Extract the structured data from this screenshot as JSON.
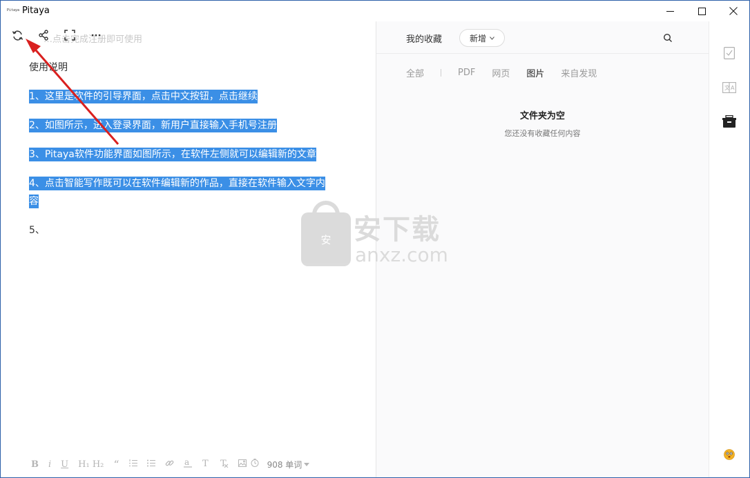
{
  "window": {
    "app_title": "Pitaya",
    "app_logo_text": "Pitaya"
  },
  "editor": {
    "ghost_text": "…点击完成注册即可使用",
    "paragraphs": [
      {
        "text": "使用说明",
        "highlighted": false
      },
      {
        "text": "1、这里是软件的引导界面，点击中文按钮，点击继续",
        "highlighted": true
      },
      {
        "text": "2、如图所示，进入登录界面，新用户直接输入手机号注册",
        "highlighted": true
      },
      {
        "text": "3、Pitaya软件功能界面如图所示，在软件左侧就可以编辑新的文章",
        "highlighted": true
      },
      {
        "text": "4、点击智能写作既可以在软件编辑新的作品，直接在软件输入文字内容",
        "highlighted": true
      },
      {
        "text": "5、",
        "highlighted": false
      }
    ],
    "format_bar": {
      "bold": "B",
      "italic": "i",
      "underline": "U",
      "headings": "H₁ H₂",
      "quote": "“",
      "word_count": "908 单词"
    }
  },
  "favorites": {
    "title": "我的收藏",
    "new_button": "新增",
    "tabs": [
      "全部",
      "PDF",
      "网页",
      "图片",
      "来自发现"
    ],
    "active_tab": "图片",
    "empty_title": "文件夹为空",
    "empty_subtitle": "您还没有收藏任何内容"
  },
  "watermark": {
    "cn": "安下载",
    "en": "anxz.com",
    "shield": "安"
  },
  "colors": {
    "highlight": "#3b8fe6",
    "arrow": "#d9201f"
  }
}
